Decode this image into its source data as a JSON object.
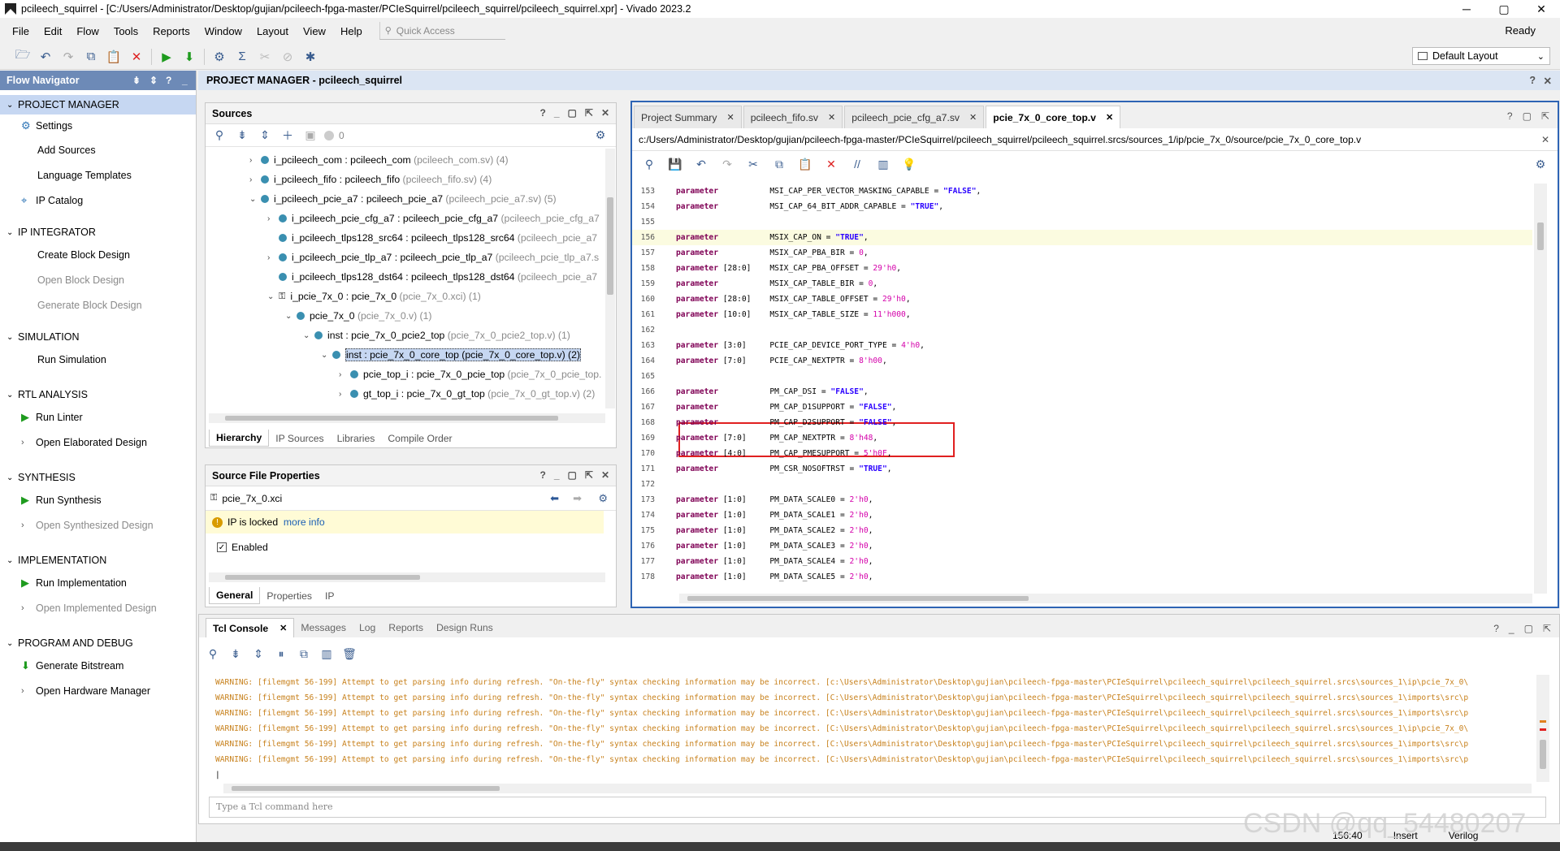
{
  "window": {
    "title": "pcileech_squirrel - [C:/Users/Administrator/Desktop/gujian/pcileech-fpga-master/PCIeSquirrel/pcileech_squirrel/pcileech_squirrel.xpr] - Vivado 2023.2",
    "minimize": "─",
    "maximize": "▢",
    "close": "✕"
  },
  "menu": {
    "items": [
      "File",
      "Edit",
      "Flow",
      "Tools",
      "Reports",
      "Window",
      "Layout",
      "View",
      "Help"
    ],
    "quick_access": "Quick Access",
    "status": "Ready"
  },
  "toolbar": {
    "layout_select": "Default Layout"
  },
  "flow_navigator": {
    "title": "Flow Navigator",
    "sections": [
      {
        "label": "PROJECT MANAGER",
        "items": [
          {
            "label": "Settings",
            "icon": "gear-icon"
          },
          {
            "label": "Add Sources"
          },
          {
            "label": "Language Templates"
          },
          {
            "label": "IP Catalog",
            "icon": "ip-icon"
          }
        ]
      },
      {
        "label": "IP INTEGRATOR",
        "items": [
          {
            "label": "Create Block Design"
          },
          {
            "label": "Open Block Design"
          },
          {
            "label": "Generate Block Design"
          }
        ]
      },
      {
        "label": "SIMULATION",
        "items": [
          {
            "label": "Run Simulation"
          }
        ]
      },
      {
        "label": "RTL ANALYSIS",
        "items": [
          {
            "label": "Run Linter"
          },
          {
            "label": "Open Elaborated Design"
          }
        ]
      },
      {
        "label": "SYNTHESIS",
        "items": [
          {
            "label": "Run Synthesis"
          },
          {
            "label": "Open Synthesized Design"
          }
        ]
      },
      {
        "label": "IMPLEMENTATION",
        "items": [
          {
            "label": "Run Implementation"
          },
          {
            "label": "Open Implemented Design"
          }
        ]
      },
      {
        "label": "PROGRAM AND DEBUG",
        "items": [
          {
            "label": "Generate Bitstream"
          },
          {
            "label": "Open Hardware Manager"
          }
        ]
      }
    ]
  },
  "project_manager": {
    "title": "PROJECT MANAGER - pcileech_squirrel"
  },
  "sources": {
    "title": "Sources",
    "count": "0",
    "tree": [
      {
        "name": "i_pcileech_com : pcileech_com",
        "meta": "(pcileech_com.sv) (4)"
      },
      {
        "name": "i_pcileech_fifo : pcileech_fifo",
        "meta": "(pcileech_fifo.sv) (4)"
      },
      {
        "name": "i_pcileech_pcie_a7 : pcileech_pcie_a7",
        "meta": "(pcileech_pcie_a7.sv) (5)"
      },
      {
        "name": "i_pcileech_pcie_cfg_a7 : pcileech_pcie_cfg_a7",
        "meta": "(pcileech_pcie_cfg_a7"
      },
      {
        "name": "i_pcileech_tlps128_src64 : pcileech_tlps128_src64",
        "meta": "(pcileech_pcie_a7"
      },
      {
        "name": "i_pcileech_pcie_tlp_a7 : pcileech_pcie_tlp_a7",
        "meta": "(pcileech_pcie_tlp_a7.s"
      },
      {
        "name": "i_pcileech_tlps128_dst64 : pcileech_tlps128_dst64",
        "meta": "(pcileech_pcie_a7"
      },
      {
        "name": "i_pcie_7x_0 : pcie_7x_0",
        "meta": "(pcie_7x_0.xci) (1)"
      },
      {
        "name": "pcie_7x_0",
        "meta": "(pcie_7x_0.v) (1)"
      },
      {
        "name": "inst : pcie_7x_0_pcie2_top",
        "meta": "(pcie_7x_0_pcie2_top.v) (1)"
      },
      {
        "name": "inst : pcie_7x_0_core_top (pcie_7x_0_core_top.v) (2)",
        "meta": ""
      },
      {
        "name": "pcie_top_i : pcie_7x_0_pcie_top",
        "meta": "(pcie_7x_0_pcie_top."
      },
      {
        "name": "gt_top_i : pcie_7x_0_gt_top",
        "meta": "(pcie_7x_0_gt_top.v) (2)"
      }
    ],
    "tabs": [
      "Hierarchy",
      "IP Sources",
      "Libraries",
      "Compile Order"
    ]
  },
  "source_props": {
    "title": "Source File Properties",
    "file": "pcie_7x_0.xci",
    "locked_msg": "IP is locked",
    "more_info": "more info",
    "enabled_label": "Enabled",
    "tabs": [
      "General",
      "Properties",
      "IP"
    ]
  },
  "editor": {
    "tabs": [
      "Project Summary",
      "pcileech_fifo.sv",
      "pcileech_pcie_cfg_a7.sv",
      "pcie_7x_0_core_top.v"
    ],
    "path": "c:/Users/Administrator/Desktop/gujian/pcileech-fpga-master/PCIeSquirrel/pcileech_squirrel/pcileech_squirrel.srcs/sources_1/ip/pcie_7x_0/source/pcie_7x_0_core_top.v",
    "lines": [
      {
        "n": "153",
        "range": "",
        "name": "MSI_CAP_PER_VECTOR_MASKING_CAPABLE",
        "val": "\"FALSE\""
      },
      {
        "n": "154",
        "range": "",
        "name": "MSI_CAP_64_BIT_ADDR_CAPABLE",
        "val": "\"TRUE\""
      },
      {
        "n": "155",
        "blank": true
      },
      {
        "n": "156",
        "range": "",
        "name": "MSIX_CAP_ON",
        "val": "\"TRUE\"",
        "hl": true
      },
      {
        "n": "157",
        "range": "",
        "name": "MSIX_CAP_PBA_BIR",
        "val": "0"
      },
      {
        "n": "158",
        "range": "[28:0]",
        "name": "MSIX_CAP_PBA_OFFSET",
        "val": "29'h0"
      },
      {
        "n": "159",
        "range": "",
        "name": "MSIX_CAP_TABLE_BIR",
        "val": "0"
      },
      {
        "n": "160",
        "range": "[28:0]",
        "name": "MSIX_CAP_TABLE_OFFSET",
        "val": "29'h0"
      },
      {
        "n": "161",
        "range": "[10:0]",
        "name": "MSIX_CAP_TABLE_SIZE",
        "val": "11'h000"
      },
      {
        "n": "162",
        "blank": true
      },
      {
        "n": "163",
        "range": "[3:0]",
        "name": "PCIE_CAP_DEVICE_PORT_TYPE",
        "val": "4'h0"
      },
      {
        "n": "164",
        "range": "[7:0]",
        "name": "PCIE_CAP_NEXTPTR",
        "val": "8'h00"
      },
      {
        "n": "165",
        "blank": true
      },
      {
        "n": "166",
        "range": "",
        "name": "PM_CAP_DSI",
        "val": "\"FALSE\""
      },
      {
        "n": "167",
        "range": "",
        "name": "PM_CAP_D1SUPPORT",
        "val": "\"FALSE\""
      },
      {
        "n": "168",
        "range": "",
        "name": "PM_CAP_D2SUPPORT",
        "val": "\"FALSE\""
      },
      {
        "n": "169",
        "range": "[7:0]",
        "name": "PM_CAP_NEXTPTR",
        "val": "8'h48"
      },
      {
        "n": "170",
        "range": "[4:0]",
        "name": "PM_CAP_PMESUPPORT",
        "val": "5'h0F"
      },
      {
        "n": "171",
        "range": "",
        "name": "PM_CSR_NOSOFTRST",
        "val": "\"TRUE\""
      },
      {
        "n": "172",
        "blank": true
      },
      {
        "n": "173",
        "range": "[1:0]",
        "name": "PM_DATA_SCALE0",
        "val": "2'h0"
      },
      {
        "n": "174",
        "range": "[1:0]",
        "name": "PM_DATA_SCALE1",
        "val": "2'h0"
      },
      {
        "n": "175",
        "range": "[1:0]",
        "name": "PM_DATA_SCALE2",
        "val": "2'h0"
      },
      {
        "n": "176",
        "range": "[1:0]",
        "name": "PM_DATA_SCALE3",
        "val": "2'h0"
      },
      {
        "n": "177",
        "range": "[1:0]",
        "name": "PM_DATA_SCALE4",
        "val": "2'h0"
      },
      {
        "n": "178",
        "range": "[1:0]",
        "name": "PM_DATA_SCALE5",
        "val": "2'h0"
      }
    ]
  },
  "console": {
    "tabs": [
      "Tcl Console",
      "Messages",
      "Log",
      "Reports",
      "Design Runs"
    ],
    "lines": [
      "WARNING: [filemgmt 56-199] Attempt to get parsing info during refresh. \"On-the-fly\" syntax checking information may be incorrect. [c:\\Users\\Administrator\\Desktop\\gujian\\pcileech-fpga-master\\PCIeSquirrel\\pcileech_squirrel\\pcileech_squirrel.srcs\\sources_1\\ip\\pcie_7x_0\\",
      "WARNING: [filemgmt 56-199] Attempt to get parsing info during refresh. \"On-the-fly\" syntax checking information may be incorrect. [C:\\Users\\Administrator\\Desktop\\gujian\\pcileech-fpga-master\\PCIeSquirrel\\pcileech_squirrel\\pcileech_squirrel.srcs\\sources_1\\imports\\src\\p",
      "WARNING: [filemgmt 56-199] Attempt to get parsing info during refresh. \"On-the-fly\" syntax checking information may be incorrect. [C:\\Users\\Administrator\\Desktop\\gujian\\pcileech-fpga-master\\PCIeSquirrel\\pcileech_squirrel\\pcileech_squirrel.srcs\\sources_1\\imports\\src\\p",
      "WARNING: [filemgmt 56-199] Attempt to get parsing info during refresh. \"On-the-fly\" syntax checking information may be incorrect. [C:\\Users\\Administrator\\Desktop\\gujian\\pcileech-fpga-master\\PCIeSquirrel\\pcileech_squirrel\\pcileech_squirrel.srcs\\sources_1\\ip\\pcie_7x_0\\",
      "WARNING: [filemgmt 56-199] Attempt to get parsing info during refresh. \"On-the-fly\" syntax checking information may be incorrect. [C:\\Users\\Administrator\\Desktop\\gujian\\pcileech-fpga-master\\PCIeSquirrel\\pcileech_squirrel\\pcileech_squirrel.srcs\\sources_1\\imports\\src\\p",
      "WARNING: [filemgmt 56-199] Attempt to get parsing info during refresh. \"On-the-fly\" syntax checking information may be incorrect. [C:\\Users\\Administrator\\Desktop\\gujian\\pcileech-fpga-master\\PCIeSquirrel\\pcileech_squirrel\\pcileech_squirrel.srcs\\sources_1\\imports\\src\\p"
    ],
    "placeholder": "Type a Tcl command here"
  },
  "statusbar": {
    "position": "156:40",
    "mode": "Insert",
    "lang": "Verilog"
  },
  "watermark": "CSDN @qq_54480207"
}
